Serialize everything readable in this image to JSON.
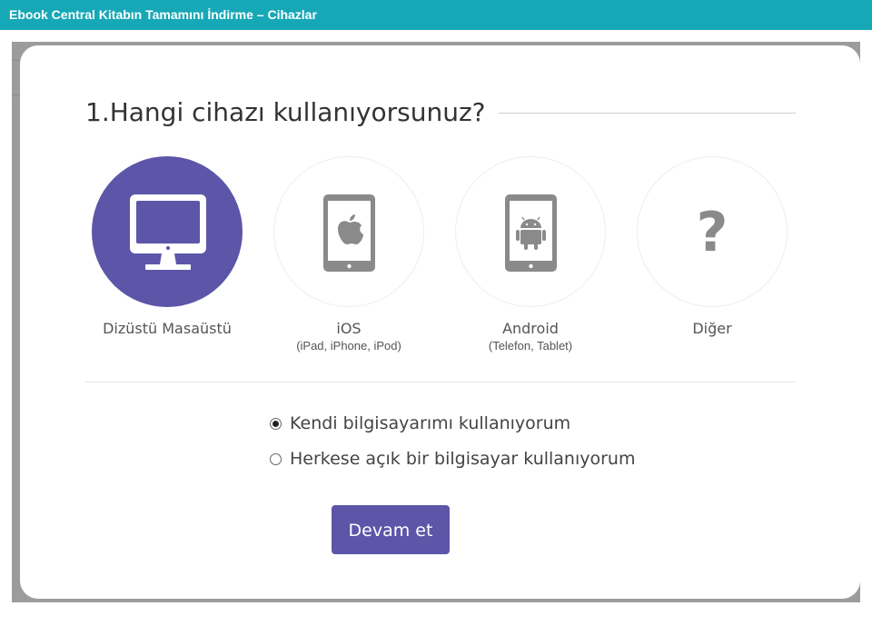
{
  "window": {
    "title": "Ebook Central Kitabın Tamamını İndirme – Cihazlar"
  },
  "modal": {
    "heading": "1.Hangi cihazı kullanıyorsunuz?",
    "devices": [
      {
        "label": "Dizüstü Masaüstü",
        "sub": "",
        "icon": "desktop-monitor-icon",
        "selected": true
      },
      {
        "label": "iOS",
        "sub": "(iPad, iPhone, iPod)",
        "icon": "apple-tablet-icon",
        "selected": false
      },
      {
        "label": "Android",
        "sub": "(Telefon, Tablet)",
        "icon": "android-tablet-icon",
        "selected": false
      },
      {
        "label": "Diğer",
        "sub": "",
        "icon": "question-mark-icon",
        "selected": false
      }
    ],
    "options": [
      {
        "label": "Kendi bilgisayarımı kullanıyorum",
        "checked": true
      },
      {
        "label": "Herkese açık bir bilgisayar kullanıyorum",
        "checked": false
      }
    ],
    "continue_label": "Devam et",
    "question_glyph": "?"
  },
  "colors": {
    "titlebar": "#17a8b7",
    "accent": "#5d55a8",
    "icon_gray": "#8a8a8a"
  }
}
